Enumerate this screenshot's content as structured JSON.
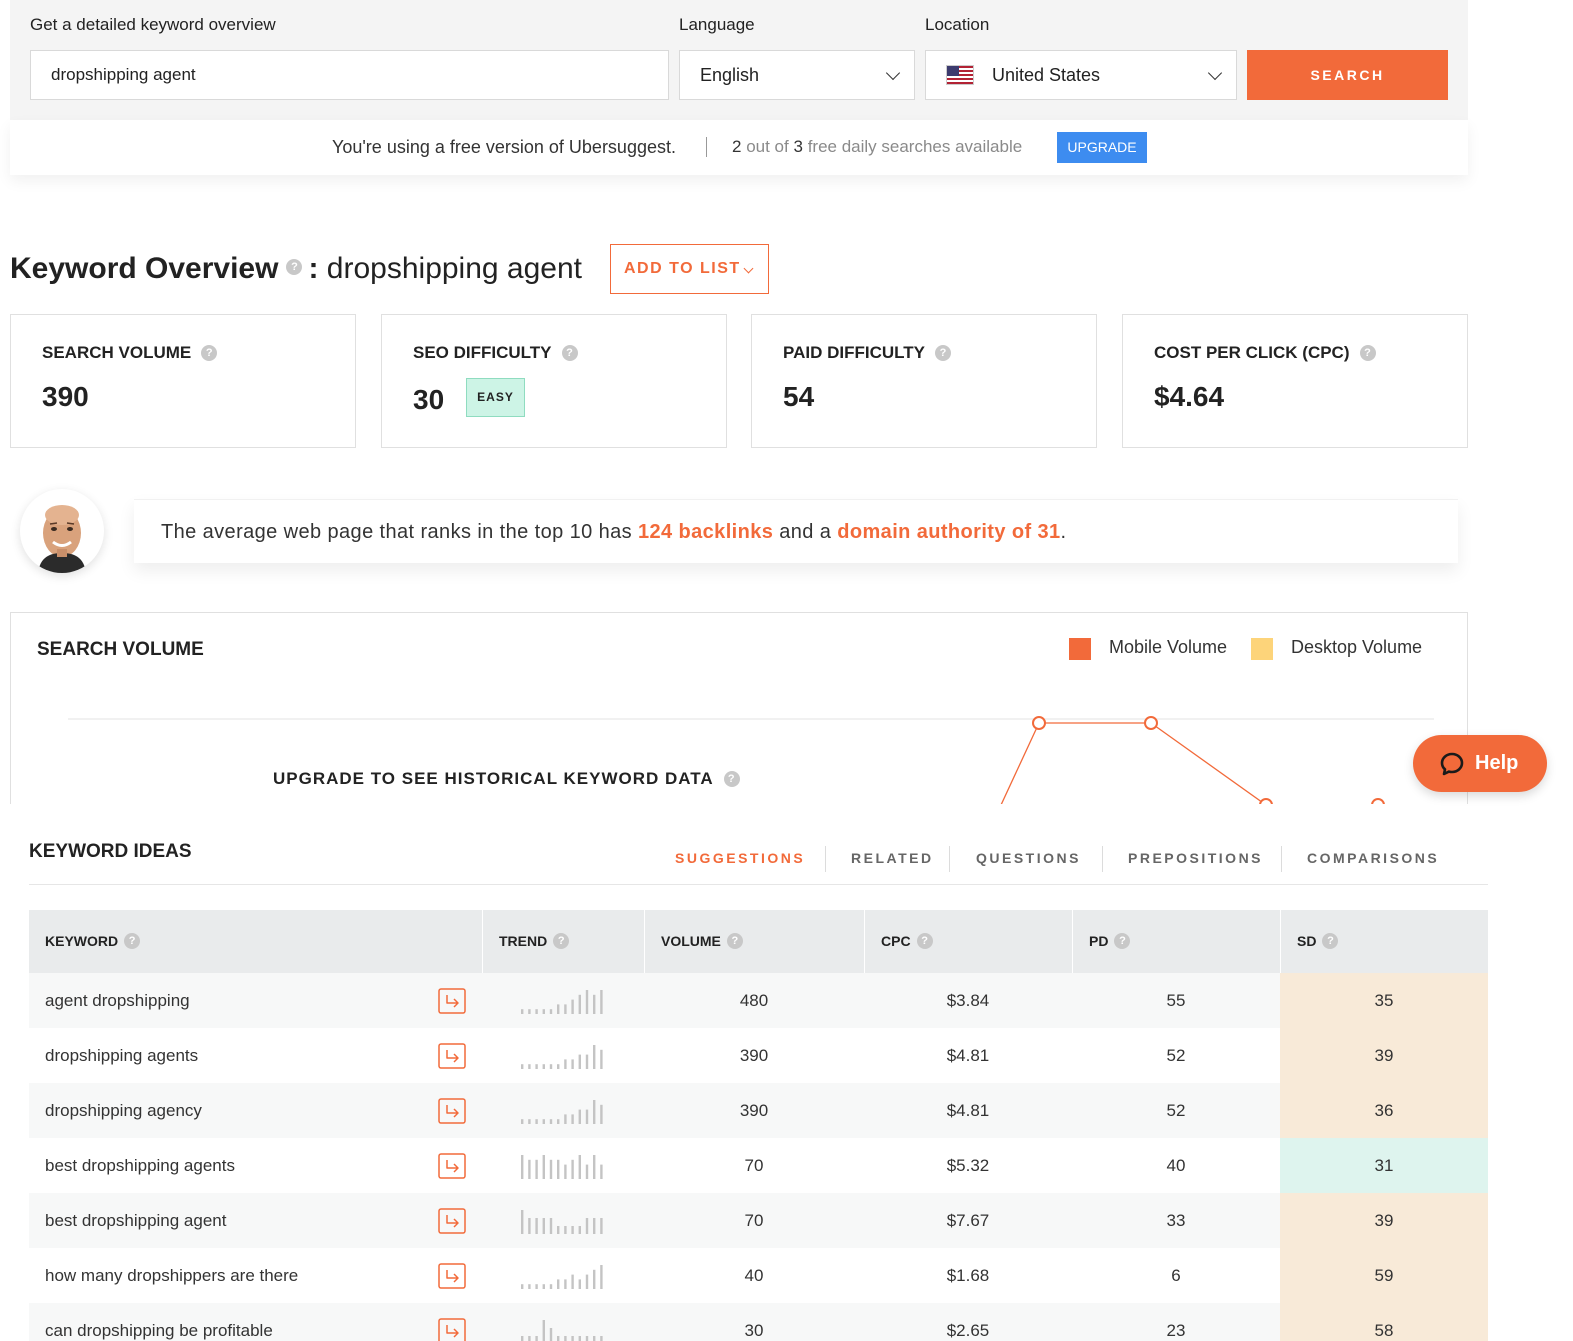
{
  "search": {
    "keyword_label": "Get a detailed keyword overview",
    "keyword_value": "dropshipping agent",
    "language_label": "Language",
    "language_value": "English",
    "location_label": "Location",
    "location_value": "United States",
    "search_button": "SEARCH"
  },
  "free_bar": {
    "message": "You're using a free version of Ubersuggest.",
    "used": "2",
    "out_of": "out of",
    "total": "3",
    "suffix": "free daily searches available",
    "upgrade_button": "UPGRADE"
  },
  "overview": {
    "title": "Keyword Overview",
    "separator": ":",
    "keyword": "dropshipping agent",
    "add_to_list": "ADD TO LIST"
  },
  "metrics": [
    {
      "label": "SEARCH VOLUME",
      "value": "390"
    },
    {
      "label": "SEO DIFFICULTY",
      "value": "30",
      "badge": "EASY"
    },
    {
      "label": "PAID DIFFICULTY",
      "value": "54"
    },
    {
      "label": "COST PER CLICK (CPC)",
      "value": "$4.64"
    }
  ],
  "insight": {
    "prefix": "The average web page that ranks in the top 10 has ",
    "backlinks": "124 backlinks",
    "middle": " and a ",
    "authority": "domain authority of 31",
    "suffix": "."
  },
  "volume_chart": {
    "title": "SEARCH VOLUME",
    "legend_mobile": "Mobile Volume",
    "legend_desktop": "Desktop Volume",
    "upgrade_message": "UPGRADE TO SEE HISTORICAL KEYWORD DATA",
    "colors": {
      "mobile": "#f26a3a",
      "desktop": "#fdd47a"
    }
  },
  "help": {
    "label": "Help"
  },
  "ideas": {
    "title": "KEYWORD IDEAS",
    "tabs": [
      "SUGGESTIONS",
      "RELATED",
      "QUESTIONS",
      "PREPOSITIONS",
      "COMPARISONS"
    ],
    "active_tab": "SUGGESTIONS",
    "columns": [
      "KEYWORD",
      "TREND",
      "VOLUME",
      "CPC",
      "PD",
      "SD"
    ],
    "rows": [
      {
        "keyword": "agent dropshipping",
        "volume": "480",
        "cpc": "$3.84",
        "pd": "55",
        "sd": "35",
        "trend": [
          1,
          1,
          1,
          1,
          1,
          2,
          2,
          3,
          4,
          5,
          4,
          5
        ]
      },
      {
        "keyword": "dropshipping agents",
        "volume": "390",
        "cpc": "$4.81",
        "pd": "52",
        "sd": "39",
        "trend": [
          1,
          1,
          1,
          1,
          1,
          1,
          2,
          2,
          3,
          3,
          5,
          4
        ]
      },
      {
        "keyword": "dropshipping agency",
        "volume": "390",
        "cpc": "$4.81",
        "pd": "52",
        "sd": "36",
        "trend": [
          1,
          1,
          1,
          1,
          1,
          1,
          2,
          2,
          3,
          3,
          5,
          4
        ]
      },
      {
        "keyword": "best dropshipping agents",
        "volume": "70",
        "cpc": "$5.32",
        "pd": "40",
        "sd": "31",
        "trend": [
          5,
          4,
          4,
          5,
          4,
          4,
          3,
          4,
          5,
          3,
          5,
          3
        ]
      },
      {
        "keyword": "best dropshipping agent",
        "volume": "70",
        "cpc": "$7.67",
        "pd": "33",
        "sd": "39",
        "trend": [
          3,
          2,
          2,
          2,
          2,
          1,
          1,
          1,
          1,
          2,
          2,
          2
        ]
      },
      {
        "keyword": "how many dropshippers are there",
        "volume": "40",
        "cpc": "$1.68",
        "pd": "6",
        "sd": "59",
        "trend": [
          1,
          1,
          1,
          1,
          1,
          2,
          2,
          3,
          2,
          3,
          4,
          5
        ]
      },
      {
        "keyword": "can dropshipping be profitable",
        "volume": "30",
        "cpc": "$2.65",
        "pd": "23",
        "sd": "58",
        "trend": [
          1,
          1,
          1,
          3,
          2,
          1,
          1,
          1,
          1,
          1,
          1,
          1
        ]
      }
    ],
    "sd_colors": {
      "warm": "#f8ead8",
      "cool": "#def4ee"
    }
  }
}
